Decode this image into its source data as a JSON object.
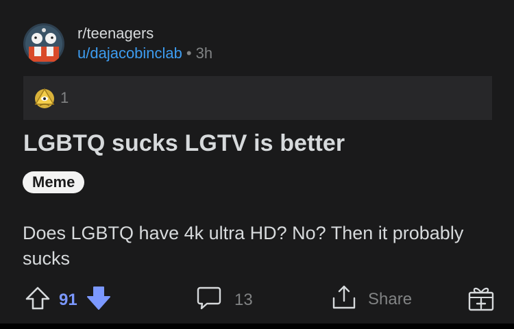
{
  "header": {
    "subreddit": "r/teenagers",
    "username": "u/dajacobinclab",
    "separator": "•",
    "time_ago": "3h",
    "avatar_icon": "subreddit-avatar"
  },
  "awards": {
    "icon": "award-icon",
    "count": "1"
  },
  "post": {
    "title": "LGBTQ sucks LGTV is better",
    "flair": "Meme",
    "body": "Does LGBTQ have 4k ultra HD? No? Then it probably sucks"
  },
  "actions": {
    "upvote_icon": "upvote-icon",
    "vote_count": "91",
    "downvote_icon": "downvote-icon",
    "comment_icon": "comment-icon",
    "comment_count": "13",
    "share_icon": "share-icon",
    "share_label": "Share",
    "gift_icon": "award-gift-icon"
  },
  "colors": {
    "background": "#1a1a1b",
    "username": "#3d9cf0",
    "vote_active": "#7b98ff",
    "muted": "#818384"
  }
}
